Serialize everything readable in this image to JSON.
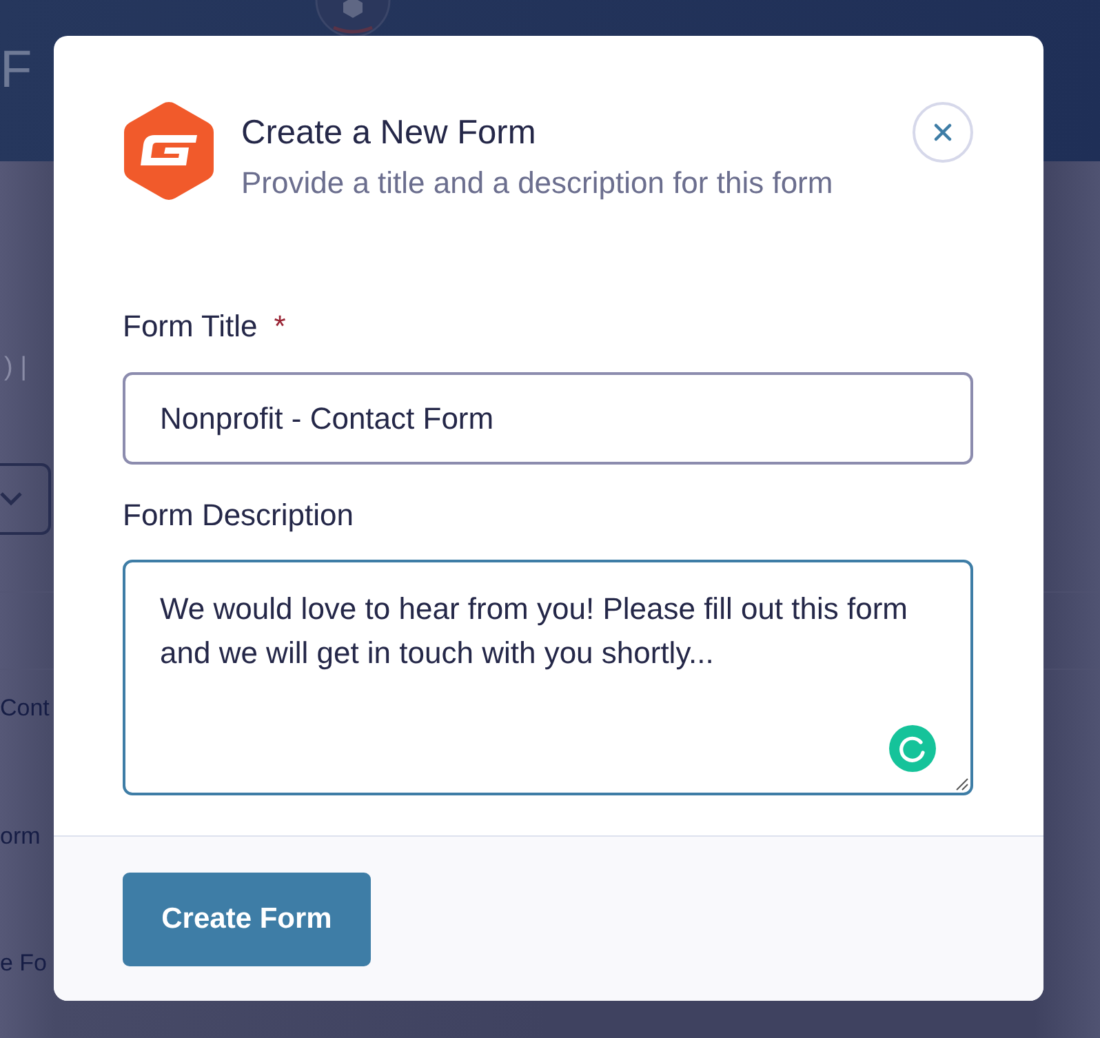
{
  "background": {
    "header_text": "F",
    "toolbar_text": ") |",
    "list_items": [
      "Cont",
      "orm",
      "e Fo"
    ]
  },
  "dialog": {
    "title": "Create a New Form",
    "subtitle": "Provide a title and a description for this form",
    "fields": [
      {
        "kind": "input",
        "label": "Form Title",
        "required_mark": "*",
        "value": "Nonprofit - Contact Form",
        "focused": false
      },
      {
        "kind": "textarea",
        "label": "Form Description",
        "value": "We would love to hear from you! Please fill out this form and we will get in touch with you shortly...",
        "focused": true
      }
    ],
    "submit_button": "Create Form"
  }
}
